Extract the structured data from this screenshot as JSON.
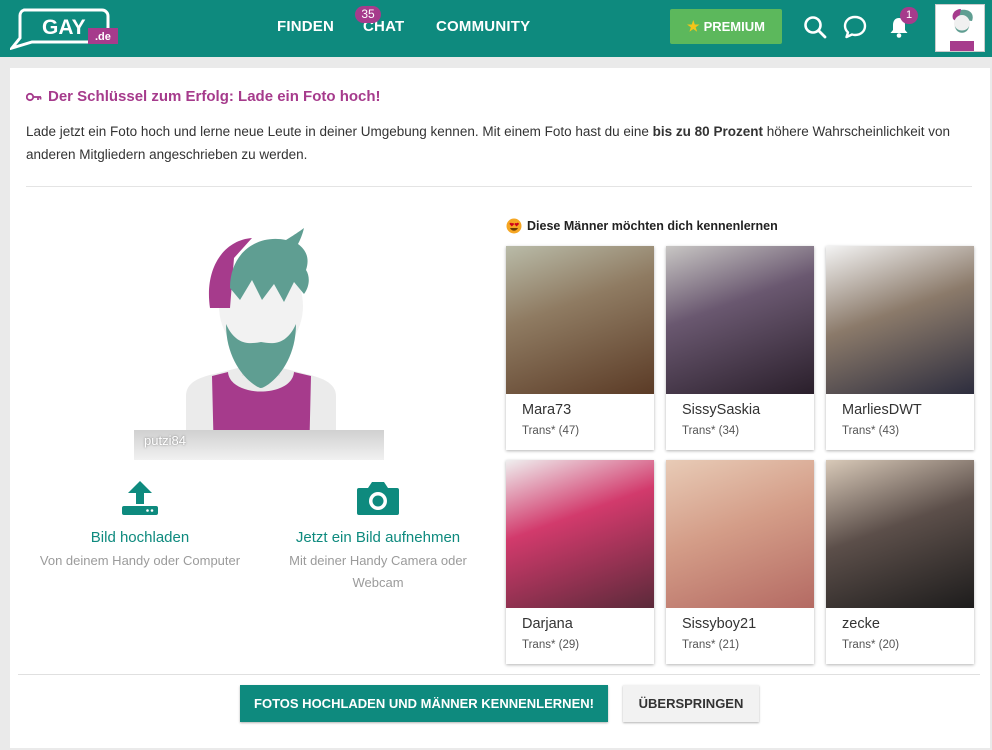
{
  "header": {
    "logo_text": "GAY",
    "logo_tld": ".de",
    "nav": [
      {
        "label": "FINDEN"
      },
      {
        "label": "CHAT",
        "badge": "35"
      },
      {
        "label": "COMMUNITY"
      }
    ],
    "premium_label": "PREMIUM",
    "notification_count": "1",
    "icons": [
      "search-icon",
      "chat-bubble-icon",
      "bell-icon",
      "user-avatar"
    ]
  },
  "main": {
    "title": "Der Schlüssel zum Erfolg: Lade ein Foto hoch!",
    "intro_before": "Lade jetzt ein Foto hoch und lerne neue Leute in deiner Umgebung kennen. Mit einem Foto hast du eine ",
    "intro_bold": "bis zu 80 Prozent",
    "intro_after": " höhere Wahrscheinlichkeit von anderen Mitgliedern angeschrieben zu werden.",
    "username": "putzi84",
    "upload": {
      "label": "Bild hochladen",
      "sub": "Von deinem Handy oder Computer"
    },
    "camera": {
      "label": "Jetzt ein Bild aufnehmen",
      "sub": "Mit deiner Handy Camera oder Webcam"
    },
    "suggest_title": "Diese Männer möchten dich kennenlernen",
    "profiles": [
      {
        "name": "Mara73",
        "meta": "Trans* (47)"
      },
      {
        "name": "SissySaskia",
        "meta": "Trans* (34)"
      },
      {
        "name": "MarliesDWT",
        "meta": "Trans* (43)"
      },
      {
        "name": "Darjana",
        "meta": "Trans* (29)"
      },
      {
        "name": "Sissyboy21",
        "meta": "Trans* (21)"
      },
      {
        "name": "zecke",
        "meta": "Trans* (20)"
      }
    ],
    "primary_button": "FOTOS HOCHLADEN UND MÄNNER KENNENLERNEN!",
    "skip_button": "ÜBERSPRINGEN"
  },
  "colors": {
    "brand": "#0e8a7e",
    "accent": "#a63b8c",
    "premium": "#5cb85c"
  }
}
